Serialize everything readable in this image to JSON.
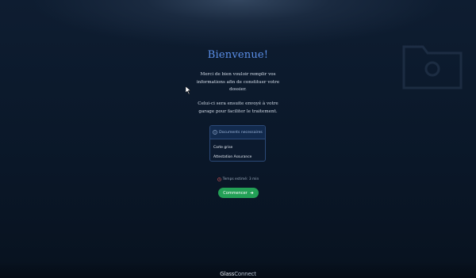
{
  "welcome": {
    "title": "Bienvenue!",
    "intro": "Merci de bien vouloir remplir vos informations afin de constituer votre dossier.",
    "details": "Celui-ci sera ensuite envoyé à votre garage pour faciliter le traitement."
  },
  "documents": {
    "header": "Documents necessaires",
    "icon": "info-icon",
    "items": [
      "Carte grise",
      "Attestation Assurance"
    ]
  },
  "time": {
    "icon": "clock-icon",
    "label": "Temps estimé: 3 min"
  },
  "start_button": {
    "label": "Commencer",
    "icon": "arrow-right-icon"
  },
  "footer": {
    "logo_bold": "Glass",
    "logo_light": "Connect"
  },
  "colors": {
    "accent": "#5b8fe8",
    "button": "#23a056",
    "background": "#0a1728"
  }
}
